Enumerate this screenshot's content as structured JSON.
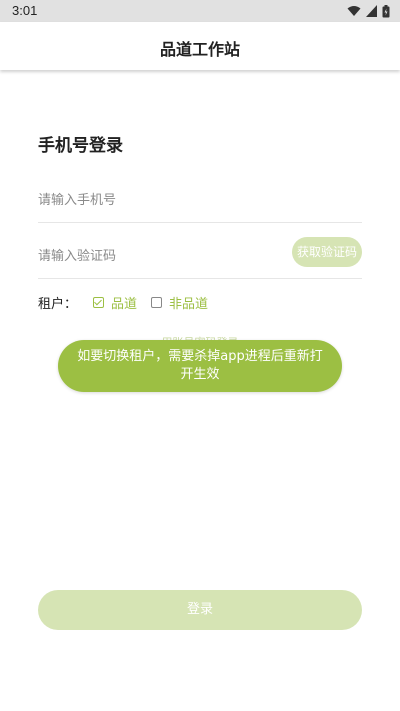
{
  "status_bar": {
    "time": "3:01",
    "icons": [
      "wifi-icon",
      "signal-icon",
      "battery-icon"
    ]
  },
  "app_bar": {
    "title": "品道工作站"
  },
  "login": {
    "title": "手机号登录",
    "phone_placeholder": "请输入手机号",
    "code_placeholder": "请输入验证码",
    "get_code_label": "获取验证码",
    "tenant_label": "租户：",
    "tenant_options": [
      {
        "label": "品道",
        "checked": true
      },
      {
        "label": "非品道",
        "checked": false
      }
    ],
    "account_login_link": "用账号密码登录",
    "submit_label": "登录"
  },
  "toast": {
    "message": "如要切换租户，需要杀掉app进程后重新打开生效"
  },
  "colors": {
    "accent": "#9cbf43",
    "accent_light": "#d6e4b4",
    "status_bar": "#e1e1e1"
  }
}
